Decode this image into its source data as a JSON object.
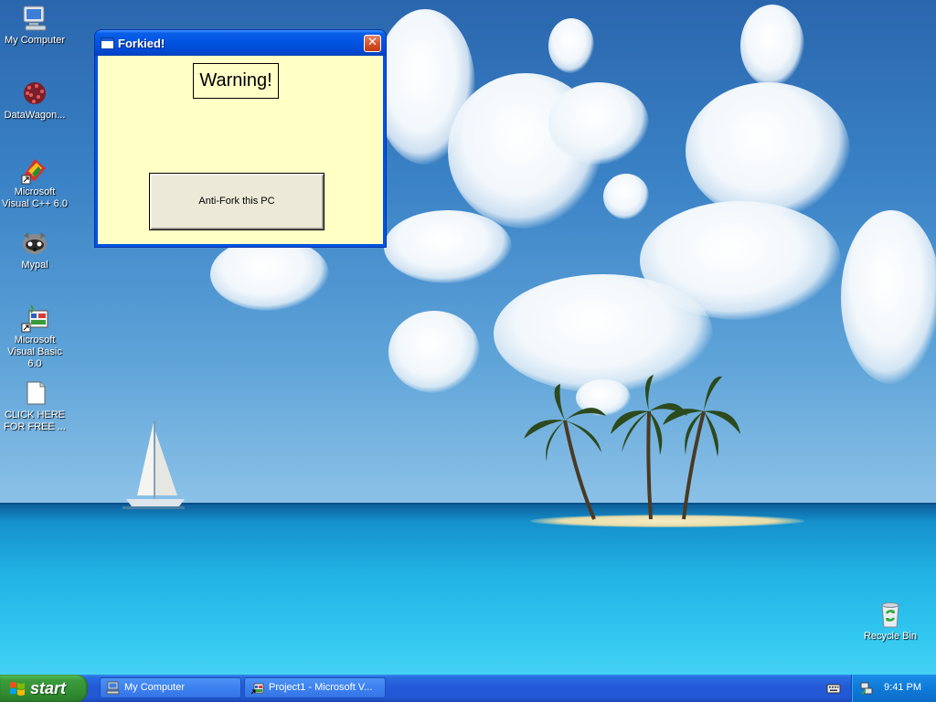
{
  "desktop": {
    "icons": [
      {
        "label": "My Computer",
        "icon": "my-computer-icon"
      },
      {
        "label": "DataWagon...",
        "icon": "datawagon-icon"
      },
      {
        "label": "Microsoft Visual C++ 6.0",
        "icon": "visual-cpp-icon"
      },
      {
        "label": "Mypal",
        "icon": "mypal-icon"
      },
      {
        "label": "Microsoft Visual Basic 6.0",
        "icon": "visual-basic-icon"
      },
      {
        "label": "CLICK HERE FOR FREE ...",
        "icon": "blank-document-icon"
      },
      {
        "label": "Recycle Bin",
        "icon": "recycle-bin-icon"
      }
    ]
  },
  "window": {
    "title": "Forkied!",
    "warning_label": "Warning!",
    "button_label": "Anti-Fork this PC",
    "close_glyph": "✕",
    "client_color": "#ffffc6"
  },
  "taskbar": {
    "start_label": "start",
    "tasks": [
      {
        "label": "My Computer",
        "icon": "my-computer-icon"
      },
      {
        "label": "Project1 - Microsoft V...",
        "icon": "visual-basic-icon"
      }
    ],
    "clock": "9:41 PM"
  }
}
